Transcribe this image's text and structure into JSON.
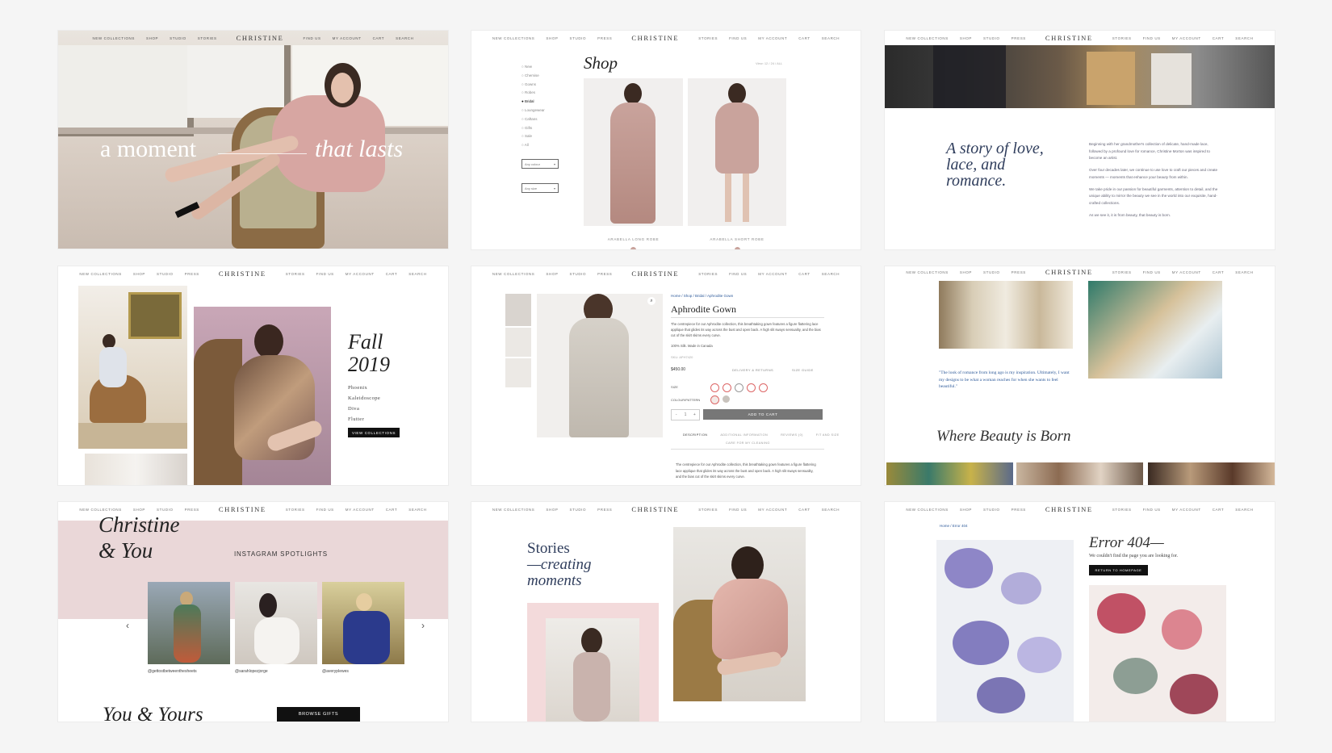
{
  "nav": {
    "brand": "CHRISTINE",
    "left": [
      "New Collections",
      "Shop",
      "Studio",
      "Stories"
    ],
    "left_press": [
      "New Collections",
      "Shop",
      "Studio",
      "Press"
    ],
    "right": [
      "Find Us",
      "My Account",
      "Cart",
      "Search"
    ],
    "right_stories": [
      "Stories",
      "Find Us",
      "My Account",
      "Cart",
      "Search"
    ]
  },
  "hero": {
    "left": "a moment",
    "right": "that lasts"
  },
  "shop": {
    "title": "Shop",
    "view": "View: 12 / 24 / ALL",
    "categories": [
      "New",
      "Chemise",
      "Gowns",
      "Robes",
      "Bridal",
      "Loungewear",
      "Caftans",
      "Gifts",
      "Sale",
      "All"
    ],
    "filters": [
      "Any colour",
      "Any size"
    ],
    "products": [
      "ARABELLA LONG ROBE",
      "ARABELLA SHORT ROBE"
    ]
  },
  "story": {
    "heading": [
      "A story of love,",
      "lace, and",
      "romance."
    ],
    "paragraphs": [
      "Beginning with her grandmother's collection of delicate, hand-made lace, followed by a profound love for romance, Christine Morton was inspired to become an artist.",
      "Over four decades later, we continue to use love to craft our pieces and create moments — moments that enhance your beauty from within.",
      "We take pride in our passion for beautiful garments, attention to detail, and the unique ability to mirror the beauty we see in the world into our exquisite, hand-crafted collections.",
      "As we see it, it is from beauty, that beauty is born."
    ]
  },
  "fall": {
    "title": [
      "Fall",
      "2019"
    ],
    "collections": [
      "Phoenix",
      "Kaleidoscope",
      "Diva",
      "Flutter"
    ],
    "button": "VIEW COLLECTIONS"
  },
  "product": {
    "breadcrumb": "Home / Shop / Bridal / Aphrodite Gown",
    "name": "Aphrodite Gown",
    "description": "The centrepiece for our Aphrodite collection, this breathtaking gown features a figure flattering lace applique that glides its way across the bust and open back. A high slit sways sensuality, and the bias cut of the skirt skims every curve.",
    "material": "100% Silk. Made in Canada",
    "sku": "SKU: APH7420",
    "price": "$450.00",
    "delivery": "DELIVERY & RETURNS",
    "size_guide": "SIZE GUIDE",
    "size_label": "SIZE",
    "colour_label": "COLOUR/PATTERN",
    "add_to_cart": "ADD TO CART",
    "qty": "1",
    "tabs": [
      "DESCRIPTION",
      "ADDITIONAL INFORMATION",
      "REVIEWS (0)",
      "FIT AND SIZE"
    ],
    "care": "CARE FOR MY CLEANING",
    "long_description": "The centrepiece for our Aphrodite collection, this breathtaking gown features a figure flattering lace applique that glides its way across the bust and open back. A high slit sways sensuality, and the bias cut of the skirt skims every curve."
  },
  "studio": {
    "quote": "\"The look of romance from long ago is my inspiration. Ultimately, I want my designs to be what a woman reaches for when she wants to feel beautiful.\"",
    "heading": "Where Beauty is Born"
  },
  "insta": {
    "title": [
      "Christine",
      "& You"
    ],
    "label": "INSTAGRAM SPOTLIGHTS",
    "handles": [
      "@gettostbetweenthesheets",
      "@sarahlopezjorge",
      "@averyplewes"
    ],
    "footer": "You & Yours",
    "button": "BROWSE GIFTS",
    "prev": "‹",
    "next": "›"
  },
  "stories": {
    "heading": [
      "Stories",
      "—creating",
      "moments"
    ]
  },
  "error": {
    "breadcrumb": "Home / Error 404",
    "title": "Error 404—",
    "text": "We couldn't find the page you are looking for.",
    "button": "RETURN TO HOMEPAGE"
  },
  "colors": {
    "navy": "#2f3d5c",
    "blush": "#ead7d8",
    "pink_panel": "#f3dadb",
    "background": "#f5f5f5"
  }
}
